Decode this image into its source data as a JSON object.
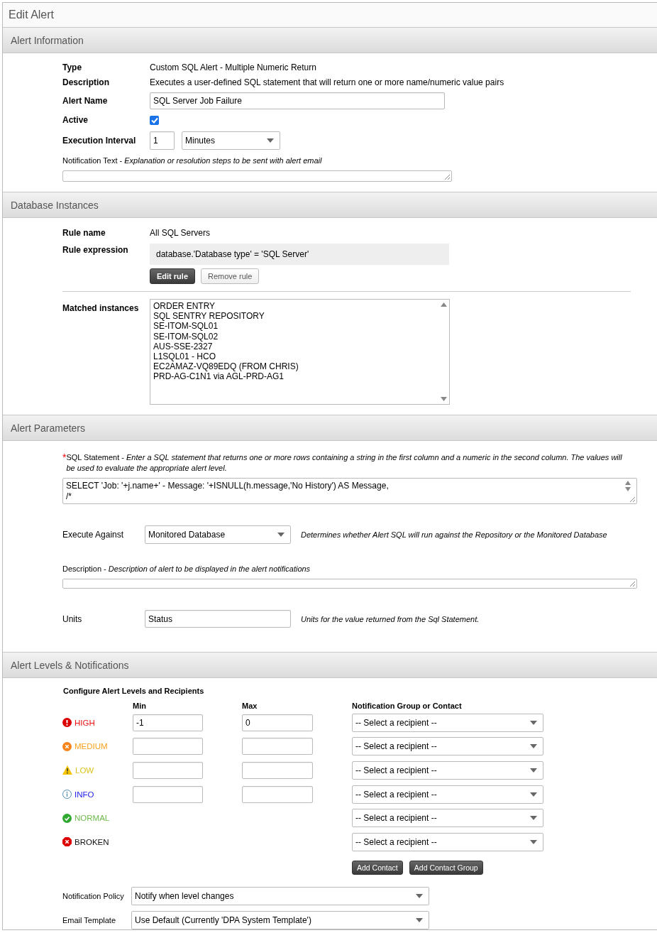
{
  "title": "Edit Alert",
  "alert_information": {
    "header": "Alert Information",
    "type_label": "Type",
    "type_value": "Custom SQL Alert - Multiple Numeric Return",
    "description_label": "Description",
    "description_value": "Executes a user-defined SQL statement that will return one or more name/numeric value pairs",
    "name_label": "Alert Name",
    "name_value": "SQL Server Job Failure",
    "active_label": "Active",
    "active_checked": true,
    "interval_label": "Execution Interval",
    "interval_value": "1",
    "interval_unit": "Minutes",
    "notification_text_label": "Notification Text - *Explanation or resolution steps to be sent with alert email*"
  },
  "database_instances": {
    "header": "Database Instances",
    "rule_name_label": "Rule name",
    "rule_name_value": "All SQL Servers",
    "rule_expression_label": "Rule expression",
    "rule_expression_value": "database.'Database type' = 'SQL Server'",
    "buttons": [
      {
        "label": "Edit rule",
        "kind": "primary"
      },
      {
        "label": "Remove rule",
        "kind": "secondary"
      }
    ],
    "matched_label": "Matched instances",
    "matched_instances": [
      "ORDER ENTRY",
      "SQL SENTRY REPOSITORY",
      "SE-ITOM-SQL01",
      "SE-ITOM-SQL02",
      "AUS-SSE-2327",
      "L1SQL01 - HCO",
      "EC2AMAZ-VQ89EDQ (FROM CHRIS)",
      "PRD-AG-C1N1 via AGL-PRD-AG1"
    ]
  },
  "alert_parameters": {
    "header": "Alert Parameters",
    "required_mark": "*",
    "sql_label": "SQL Statement - *Enter a SQL statement that returns one or more rows containing a string in the first column and a numeric in the second column. The values will be used to evaluate the appropriate alert level.*",
    "sql_lines": [
      "SELECT 'Job: '+j.name+' - Message: '+ISNULL(h.message,'No History') AS Message,",
      "/*"
    ],
    "execute_label": "Execute Against",
    "execute_value": "Monitored Database",
    "execute_hint": "Determines whether Alert SQL will run against the Repository or the Monitored Database",
    "description_label": "Description - *Description of alert to be displayed in the alert notifications*",
    "units_label": "Units",
    "units_value": "Status",
    "units_hint": "Units for the value returned from the Sql Statement."
  },
  "alert_levels": {
    "header": "Alert Levels & Notifications",
    "configure_label": "Configure Alert Levels and Recipients",
    "columns": [
      "Min",
      "Max",
      "Notification Group or Contact"
    ],
    "levels": [
      {
        "label": "HIGH",
        "kind": "high",
        "color": "#ee1111",
        "has_range": true,
        "min": "-1",
        "max": "0",
        "recipient": "-- Select a recipient --"
      },
      {
        "label": "MEDIUM",
        "kind": "medium",
        "color": "#f7a21b",
        "has_range": true,
        "recipient": "-- Select a recipient --"
      },
      {
        "label": "LOW",
        "kind": "low",
        "color": "#d9c21a",
        "has_range": true,
        "recipient": "-- Select a recipient --"
      },
      {
        "label": "INFO",
        "kind": "info",
        "color": "#2222ee",
        "has_range": true,
        "recipient": "-- Select a recipient --"
      },
      {
        "label": "NORMAL",
        "kind": "normal",
        "color": "#6dbb4a",
        "has_range": false,
        "recipient": "-- Select a recipient --"
      },
      {
        "label": "BROKEN",
        "kind": "broken",
        "color": "#111111",
        "has_range": false,
        "recipient": "-- Select a recipient --"
      }
    ],
    "buttons": [
      "Add Contact",
      "Add Contact Group"
    ],
    "policy_label": "Notification Policy",
    "policy_value": "Notify when level changes",
    "template_label": "Email Template",
    "template_value": "Use Default (Currently 'DPA System Template')"
  }
}
